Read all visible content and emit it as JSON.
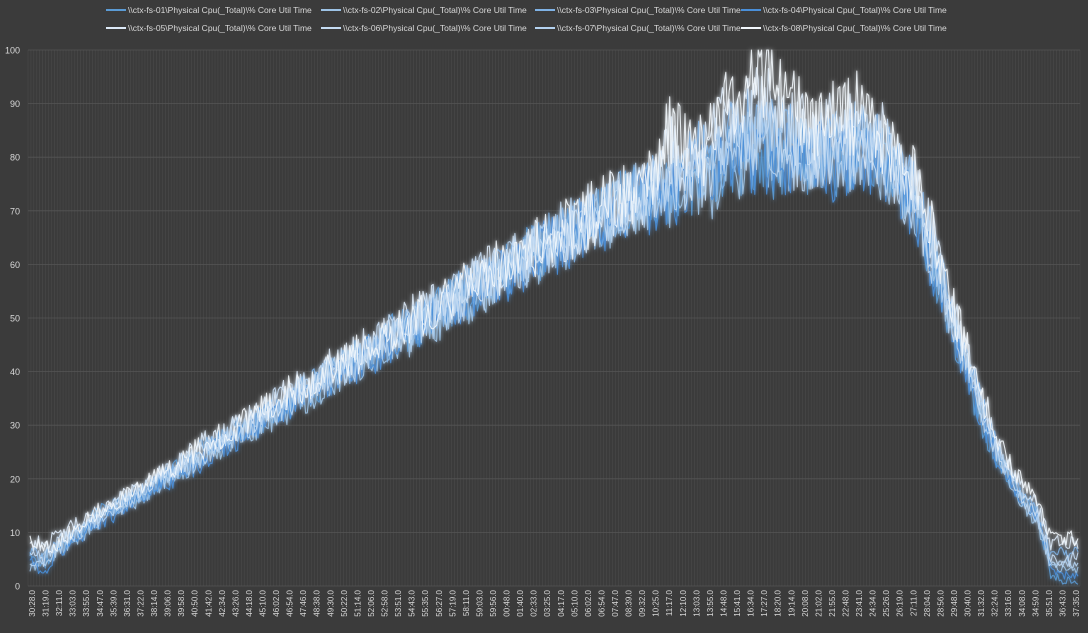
{
  "chart_data": {
    "type": "line",
    "title": "",
    "xlabel": "",
    "ylabel": "",
    "ylim": [
      0,
      100
    ],
    "yticks": [
      0,
      10,
      20,
      30,
      40,
      50,
      60,
      70,
      80,
      90,
      100
    ],
    "grid": "vertical and horizontal",
    "legend_position": "top",
    "x_tick_labels": [
      "30:28.0",
      "31:19.0",
      "32:11.0",
      "33:03.0",
      "33:55.0",
      "34:47.0",
      "35:39.0",
      "36:31.0",
      "37:22.0",
      "38:14.0",
      "39:06.0",
      "39:58.0",
      "40:50.0",
      "41:42.0",
      "42:34.0",
      "43:26.0",
      "44:18.0",
      "45:10.0",
      "46:02.0",
      "46:54.0",
      "47:46.0",
      "48:38.0",
      "49:30.0",
      "50:22.0",
      "51:14.0",
      "52:06.0",
      "52:58.0",
      "53:51.0",
      "54:43.0",
      "55:35.0",
      "56:27.0",
      "57:19.0",
      "58:11.0",
      "59:03.0",
      "59:56.0",
      "00:48.0",
      "01:40.0",
      "02:33.0",
      "03:25.0",
      "04:17.0",
      "05:10.0",
      "06:02.0",
      "06:54.0",
      "07:47.0",
      "08:39.0",
      "09:32.0",
      "10:25.0",
      "11:17.0",
      "12:10.0",
      "13:03.0",
      "13:55.0",
      "14:48.0",
      "15:41.0",
      "16:34.0",
      "17:27.0",
      "18:20.0",
      "19:14.0",
      "20:08.0",
      "21:02.0",
      "21:55.0",
      "22:48.0",
      "23:41.0",
      "24:34.0",
      "25:26.0",
      "26:19.0",
      "27:11.0",
      "28:04.0",
      "28:56.0",
      "29:48.0",
      "30:40.0",
      "31:32.0",
      "32:24.0",
      "33:16.0",
      "34:08.0",
      "34:59.0",
      "35:51.0",
      "36:43.0",
      "37:35.0"
    ],
    "series": [
      {
        "name": "\\\\ctx-fs-01\\Physical Cpu(_Total)\\% Core Util Time",
        "color": "#5b9bd5",
        "values": [
          7,
          4,
          7,
          9,
          11,
          14,
          15,
          16,
          17,
          19,
          21,
          22,
          24,
          26,
          27,
          29,
          30,
          31,
          33,
          34,
          36,
          37,
          39,
          41,
          43,
          44,
          46,
          47,
          48,
          50,
          52,
          53,
          54,
          56,
          58,
          59,
          61,
          62,
          63,
          65,
          67,
          68,
          70,
          71,
          72,
          73,
          72,
          73,
          74,
          75,
          76,
          78,
          80,
          79,
          78,
          79,
          81,
          80,
          82,
          79,
          78,
          80,
          81,
          79,
          74,
          70,
          62,
          55,
          46,
          38,
          30,
          24,
          20,
          16,
          14,
          2,
          1,
          1
        ]
      },
      {
        "name": "\\\\ctx-fs-02\\Physical Cpu(_Total)\\% Core Util Time",
        "color": "#9dc3e6",
        "values": [
          3,
          6,
          6,
          8,
          10,
          13,
          14,
          15,
          16,
          18,
          20,
          21,
          23,
          24,
          26,
          28,
          29,
          30,
          32,
          33,
          35,
          36,
          38,
          40,
          41,
          43,
          44,
          46,
          47,
          49,
          50,
          52,
          53,
          55,
          56,
          58,
          60,
          61,
          62,
          64,
          65,
          67,
          68,
          70,
          71,
          72,
          73,
          72,
          76,
          74,
          75,
          77,
          79,
          80,
          82,
          81,
          80,
          78,
          82,
          80,
          81,
          82,
          80,
          78,
          76,
          72,
          64,
          56,
          48,
          40,
          32,
          25,
          20,
          15,
          12,
          4,
          3,
          3
        ]
      },
      {
        "name": "\\\\ctx-fs-03\\Physical Cpu(_Total)\\% Core Util Time",
        "color": "#7fb2e5",
        "values": [
          6,
          6,
          7,
          9,
          11,
          12,
          14,
          16,
          17,
          18,
          20,
          22,
          23,
          25,
          27,
          28,
          30,
          31,
          33,
          35,
          36,
          38,
          39,
          41,
          42,
          44,
          45,
          47,
          49,
          50,
          51,
          53,
          55,
          56,
          58,
          59,
          61,
          62,
          64,
          65,
          66,
          68,
          69,
          71,
          72,
          73,
          74,
          75,
          78,
          80,
          78,
          82,
          84,
          86,
          85,
          84,
          83,
          82,
          81,
          83,
          82,
          84,
          82,
          80,
          77,
          73,
          66,
          58,
          49,
          41,
          33,
          26,
          21,
          17,
          14,
          6,
          6,
          6
        ]
      },
      {
        "name": "\\\\ctx-fs-04\\Physical Cpu(_Total)\\% Core Util Time",
        "color": "#4a8fd9",
        "values": [
          5,
          2,
          6,
          8,
          10,
          12,
          13,
          15,
          16,
          18,
          19,
          21,
          22,
          24,
          26,
          27,
          29,
          30,
          32,
          33,
          35,
          37,
          38,
          40,
          41,
          43,
          44,
          46,
          48,
          49,
          51,
          52,
          54,
          55,
          57,
          58,
          60,
          61,
          63,
          64,
          65,
          67,
          68,
          70,
          71,
          72,
          71,
          73,
          74,
          76,
          77,
          79,
          81,
          80,
          79,
          80,
          79,
          81,
          80,
          78,
          80,
          81,
          79,
          77,
          75,
          70,
          62,
          54,
          46,
          38,
          31,
          24,
          19,
          15,
          13,
          3,
          2,
          2
        ]
      },
      {
        "name": "\\\\ctx-fs-05\\Physical Cpu(_Total)\\% Core Util Time",
        "color": "#dce9f7",
        "values": [
          8,
          8,
          9,
          11,
          12,
          14,
          16,
          17,
          18,
          20,
          22,
          23,
          25,
          27,
          28,
          30,
          31,
          33,
          34,
          36,
          38,
          39,
          41,
          42,
          44,
          45,
          47,
          48,
          50,
          51,
          53,
          54,
          56,
          57,
          59,
          60,
          62,
          63,
          65,
          66,
          67,
          69,
          70,
          72,
          73,
          74,
          76,
          82,
          80,
          78,
          82,
          88,
          85,
          88,
          90,
          86,
          85,
          84,
          83,
          85,
          84,
          86,
          84,
          82,
          78,
          74,
          67,
          59,
          50,
          42,
          34,
          27,
          22,
          18,
          15,
          8,
          8,
          8
        ]
      },
      {
        "name": "\\\\ctx-fs-06\\Physical Cpu(_Total)\\% Core Util Time",
        "color": "#c5dcf3",
        "values": [
          6,
          5,
          8,
          10,
          11,
          13,
          15,
          16,
          18,
          19,
          21,
          23,
          24,
          26,
          27,
          29,
          31,
          32,
          34,
          35,
          37,
          38,
          40,
          41,
          43,
          45,
          46,
          48,
          49,
          51,
          52,
          54,
          55,
          57,
          58,
          60,
          61,
          63,
          64,
          66,
          67,
          68,
          70,
          71,
          72,
          74,
          75,
          78,
          77,
          76,
          79,
          82,
          83,
          85,
          84,
          83,
          82,
          80,
          82,
          81,
          83,
          84,
          82,
          80,
          76,
          72,
          65,
          57,
          48,
          40,
          32,
          25,
          20,
          16,
          13,
          5,
          5,
          5
        ]
      },
      {
        "name": "\\\\ctx-fs-07\\Physical Cpu(_Total)\\% Core Util Time",
        "color": "#b4d2f0",
        "values": [
          4,
          4,
          7,
          9,
          10,
          12,
          14,
          15,
          17,
          19,
          20,
          22,
          23,
          25,
          27,
          28,
          30,
          31,
          33,
          34,
          36,
          38,
          39,
          41,
          42,
          44,
          45,
          47,
          48,
          50,
          51,
          53,
          54,
          56,
          57,
          59,
          60,
          62,
          63,
          65,
          66,
          68,
          69,
          70,
          72,
          73,
          74,
          76,
          75,
          77,
          78,
          80,
          82,
          81,
          83,
          82,
          81,
          80,
          79,
          81,
          80,
          82,
          81,
          79,
          75,
          71,
          63,
          55,
          47,
          39,
          31,
          25,
          20,
          16,
          13,
          4,
          4,
          4
        ]
      },
      {
        "name": "\\\\ctx-fs-08\\Physical Cpu(_Total)\\% Core Util Time",
        "color": "#f2f7fc",
        "values": [
          9,
          7,
          8,
          10,
          12,
          14,
          15,
          17,
          18,
          20,
          21,
          23,
          25,
          26,
          28,
          29,
          31,
          33,
          34,
          36,
          37,
          39,
          40,
          42,
          43,
          45,
          47,
          48,
          50,
          51,
          53,
          54,
          56,
          57,
          59,
          60,
          62,
          63,
          64,
          66,
          67,
          69,
          70,
          72,
          73,
          75,
          77,
          85,
          83,
          80,
          84,
          92,
          90,
          94,
          95,
          92,
          90,
          87,
          86,
          88,
          87,
          89,
          86,
          83,
          79,
          75,
          68,
          60,
          51,
          43,
          35,
          28,
          23,
          19,
          16,
          9,
          9,
          9
        ]
      }
    ]
  }
}
